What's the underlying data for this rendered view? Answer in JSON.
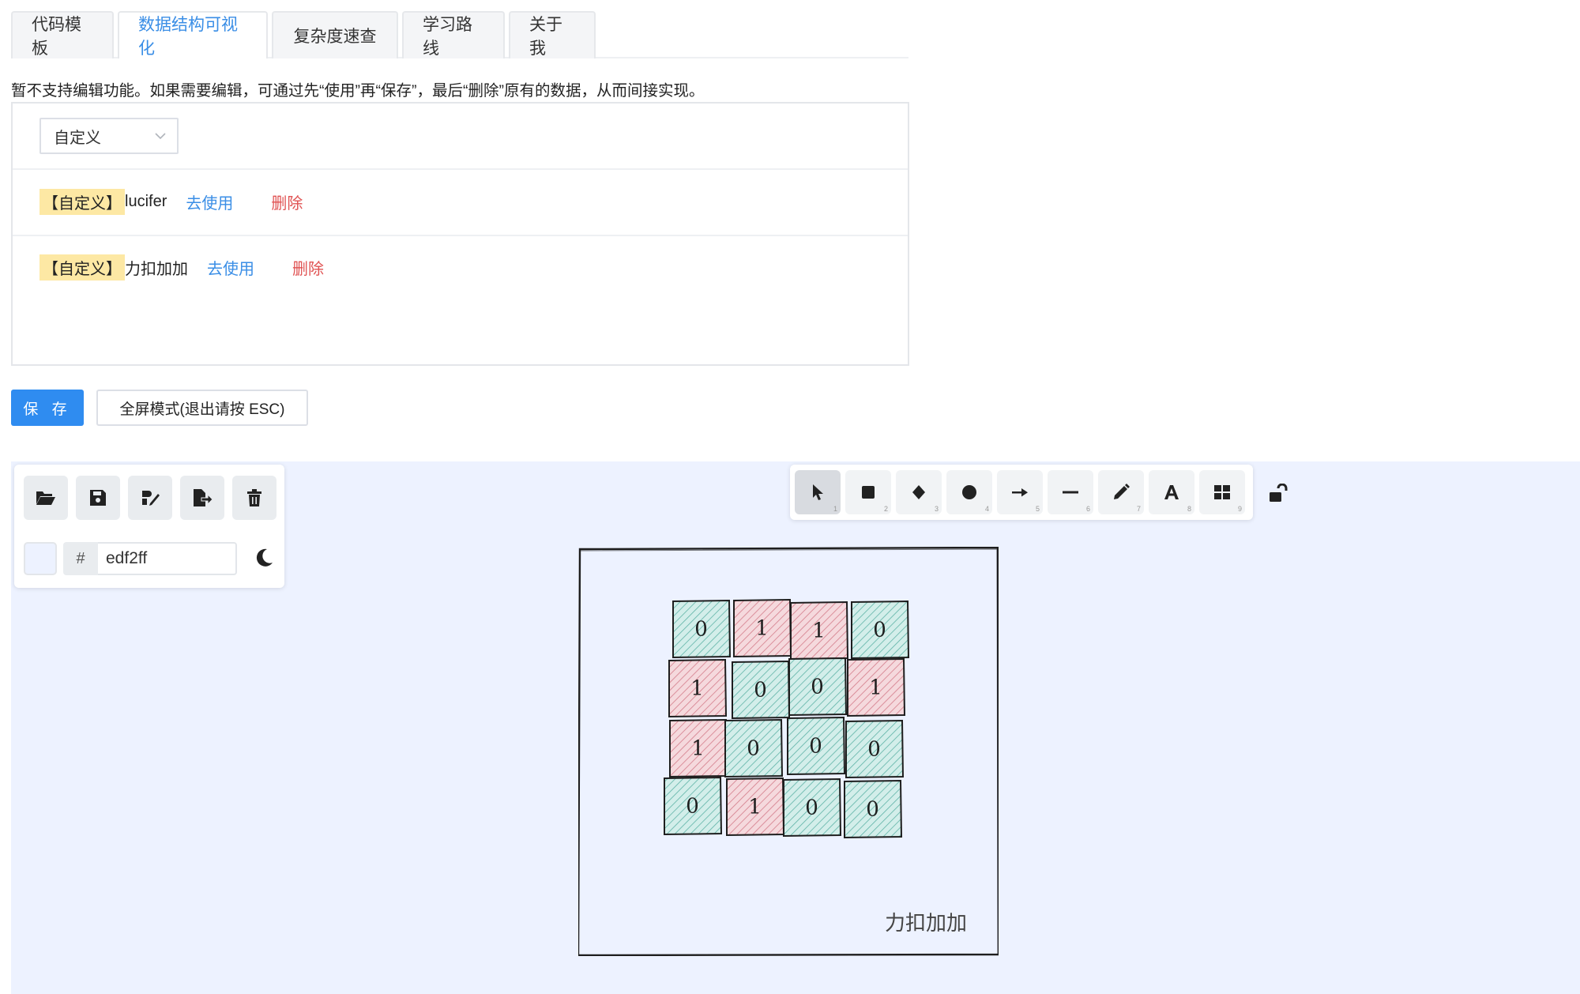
{
  "tabs": [
    {
      "label": "代码模板",
      "active": false
    },
    {
      "label": "数据结构可视化",
      "active": true
    },
    {
      "label": "复杂度速查",
      "active": false
    },
    {
      "label": "学习路线",
      "active": false
    },
    {
      "label": "关于我",
      "active": false
    }
  ],
  "notice": "暂不支持编辑功能。如果需要编辑，可通过先“使用”再“保存”，最后“删除”原有的数据，从而间接实现。",
  "select": {
    "value": "自定义",
    "icon": "chevron-down-icon"
  },
  "items": [
    {
      "tag": "【自定义】",
      "name": "lucifer",
      "use": "去使用",
      "delete": "删除"
    },
    {
      "tag": "【自定义】",
      "name": "力扣加加",
      "use": "去使用",
      "delete": "删除"
    }
  ],
  "buttons": {
    "save": "保 存",
    "fullscreen": "全屏模式(退出请按 ESC)"
  },
  "left_toolbar": {
    "icons": [
      "open-folder-icon",
      "save-icon",
      "export-image-icon",
      "export-file-icon",
      "trash-icon"
    ],
    "hash": "#",
    "bg_color": "edf2ff",
    "theme_icon": "moon-icon"
  },
  "shape_toolbar": {
    "tools": [
      {
        "icon": "pointer-icon",
        "key": "1",
        "selected": true
      },
      {
        "icon": "rectangle-icon",
        "key": "2"
      },
      {
        "icon": "diamond-icon",
        "key": "3"
      },
      {
        "icon": "ellipse-icon",
        "key": "4"
      },
      {
        "icon": "arrow-icon",
        "key": "5"
      },
      {
        "icon": "line-icon",
        "key": "6"
      },
      {
        "icon": "pencil-icon",
        "key": "7"
      },
      {
        "icon": "text-icon",
        "key": "8"
      },
      {
        "icon": "library-icon",
        "key": "9"
      }
    ],
    "lock_icon": "unlock-icon"
  },
  "drawing": {
    "grid": [
      [
        "0",
        "1",
        "1",
        "0"
      ],
      [
        "1",
        "0",
        "0",
        "1"
      ],
      [
        "1",
        "0",
        "0",
        "0"
      ],
      [
        "0",
        "1",
        "0",
        "0"
      ]
    ],
    "caption": "力扣加加",
    "colors": {
      "one": "#e8a3ad",
      "zero": "#8fd0c8",
      "canvas_bg": "#edf2ff"
    }
  }
}
